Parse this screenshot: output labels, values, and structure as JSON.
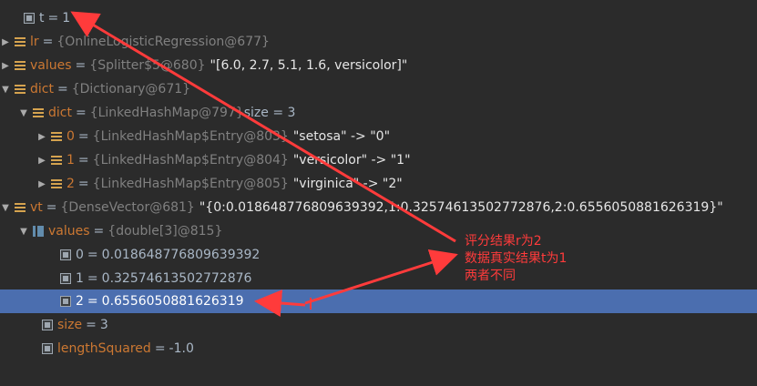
{
  "rows": [
    {
      "name": "t",
      "eq": "=",
      "value": "1"
    },
    {
      "name": "lr",
      "eq": "=",
      "ref": "{OnlineLogisticRegression@677}"
    },
    {
      "name": "values",
      "eq": "=",
      "ref": "{Splitter$5@680}",
      "str": "\"[6.0, 2.7, 5.1, 1.6, versicolor]\""
    },
    {
      "name": "dict",
      "eq": "=",
      "ref": "{Dictionary@671}"
    },
    {
      "name": "dict",
      "eq": "=",
      "ref": "{LinkedHashMap@797}",
      "str": " size = 3"
    },
    {
      "name": "0",
      "eq": "=",
      "ref": "{LinkedHashMap$Entry@803}",
      "str": "\"setosa\" -> \"0\""
    },
    {
      "name": "1",
      "eq": "=",
      "ref": "{LinkedHashMap$Entry@804}",
      "str": "\"versicolor\" -> \"1\""
    },
    {
      "name": "2",
      "eq": "=",
      "ref": "{LinkedHashMap$Entry@805}",
      "str": "\"virginica\" -> \"2\""
    },
    {
      "name": "vt",
      "eq": "=",
      "ref": "{DenseVector@681}",
      "str": "\"{0:0.018648776809639392,1:0.32574613502772876,2:0.6556050881626319}\""
    },
    {
      "name": "values",
      "eq": "=",
      "ref": "{double[3]@815}"
    },
    {
      "name": "0",
      "eq": "=",
      "value": "0.018648776809639392"
    },
    {
      "name": "1",
      "eq": "=",
      "value": "0.32574613502772876"
    },
    {
      "name": "2",
      "eq": "=",
      "value": "0.6556050881626319"
    },
    {
      "name": "size",
      "eq": "=",
      "value": "3"
    },
    {
      "name": "lengthSquared",
      "eq": "=",
      "value": "-1.0"
    }
  ],
  "annotation": {
    "line1": "评分结果r为2",
    "line2": "数据真实结果t为1",
    "line3": "两者不同",
    "color": "#ff3b3b"
  },
  "selection_color": "#4b6eaf"
}
